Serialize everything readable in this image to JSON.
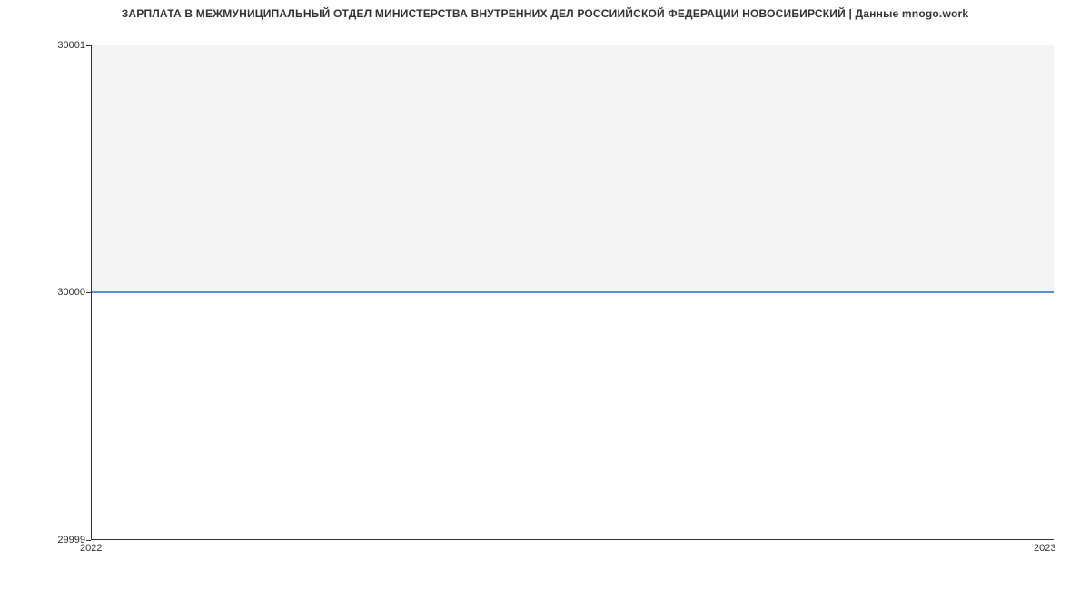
{
  "chart_data": {
    "type": "line",
    "title": "ЗАРПЛАТА В МЕЖМУНИЦИПАЛЬНЫЙ ОТДЕЛ МИНИСТЕРСТВА ВНУТРЕННИХ ДЕЛ РОССИИЙСКОЙ ФЕДЕРАЦИИ НОВОСИБИРСКИЙ | Данные mnogo.work",
    "x": [
      "2022",
      "2023"
    ],
    "values": [
      30000,
      30000
    ],
    "y_ticks": [
      29999,
      30000,
      30001
    ],
    "x_ticks": [
      "2022",
      "2023"
    ],
    "ylim": [
      29999,
      30001
    ],
    "xlabel": "",
    "ylabel": ""
  }
}
